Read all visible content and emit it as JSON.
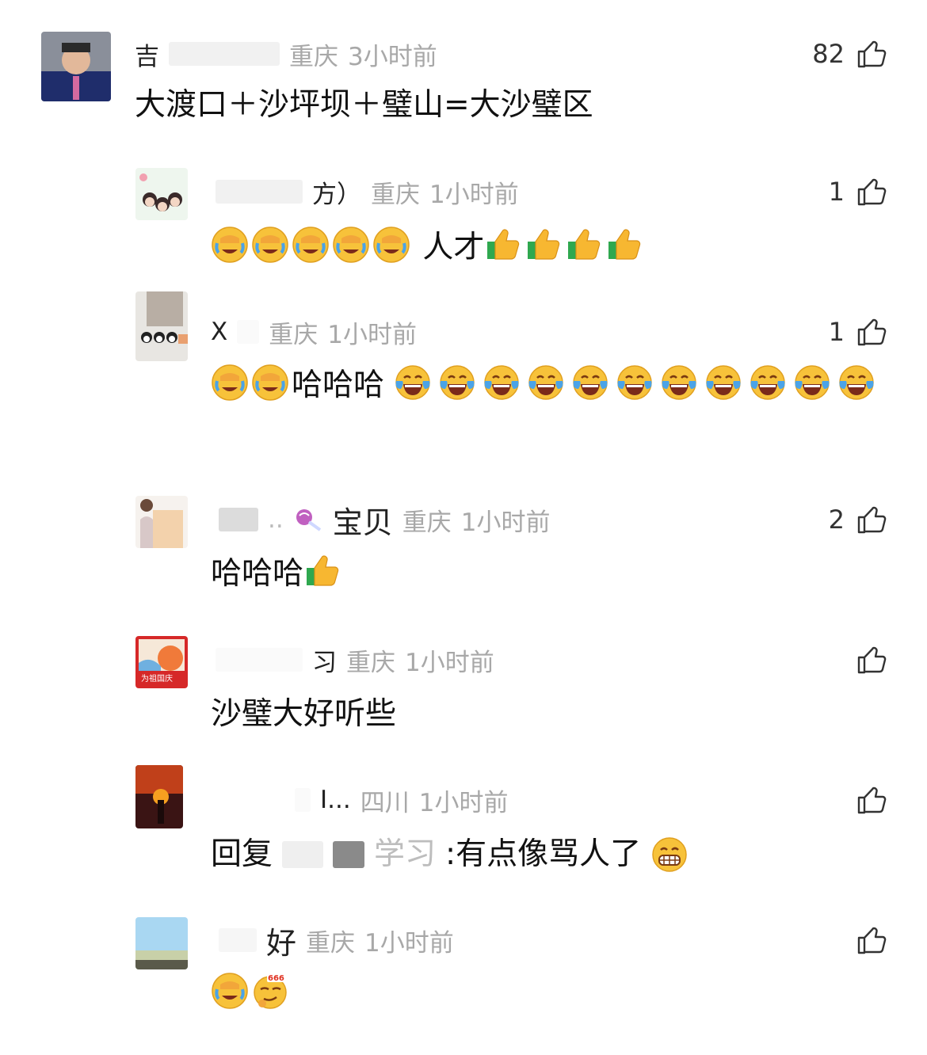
{
  "comments": [
    {
      "name": "吉",
      "region": "重庆",
      "time": "3小时前",
      "likes": "82",
      "text": "大渡口＋沙坪坝＋璧山=大沙璧区"
    },
    {
      "name": "方）",
      "region": "重庆",
      "time": "1小时前",
      "likes": "1",
      "text": "人才",
      "emoji_before": [
        "facepalm-cry",
        "facepalm-cry",
        "facepalm-cry",
        "facepalm-cry",
        "facepalm-cry"
      ],
      "emoji_after": [
        "thumbs-up",
        "thumbs-up",
        "thumbs-up",
        "thumbs-up"
      ]
    },
    {
      "name": "X",
      "region": "重庆",
      "time": "1小时前",
      "likes": "1",
      "text": "哈哈哈",
      "emoji_before": [
        "facepalm-cry",
        "facepalm-cry"
      ],
      "emoji_after": [
        "tears-of-joy",
        "tears-of-joy",
        "tears-of-joy",
        "tears-of-joy",
        "tears-of-joy",
        "tears-of-joy",
        "tears-of-joy",
        "tears-of-joy",
        "tears-of-joy",
        "tears-of-joy",
        "tears-of-joy"
      ]
    },
    {
      "name": "宝贝",
      "region": "重庆",
      "time": "1小时前",
      "likes": "2",
      "text": "哈哈哈",
      "emoji_after": [
        "thumbs-up"
      ]
    },
    {
      "name": "习",
      "region": "重庆",
      "time": "1小时前",
      "likes": "",
      "text": "沙璧大好听些"
    },
    {
      "name": "I...",
      "region": "四川",
      "time": "1小时前",
      "likes": "",
      "reply_prefix": "回复",
      "reply_target": "学习",
      "text": ":有点像骂人了",
      "emoji_after": [
        "grin"
      ]
    },
    {
      "name": "好",
      "region": "重庆",
      "time": "1小时前",
      "likes": "",
      "text": "",
      "emoji_after": [
        "facepalm-cry",
        "666-smirk"
      ]
    }
  ],
  "colors": {
    "meta_gray": "#a8a8a8",
    "text": "#111111",
    "emoji_yellow": "#f7c23a",
    "tear_blue": "#4aa3e8"
  }
}
